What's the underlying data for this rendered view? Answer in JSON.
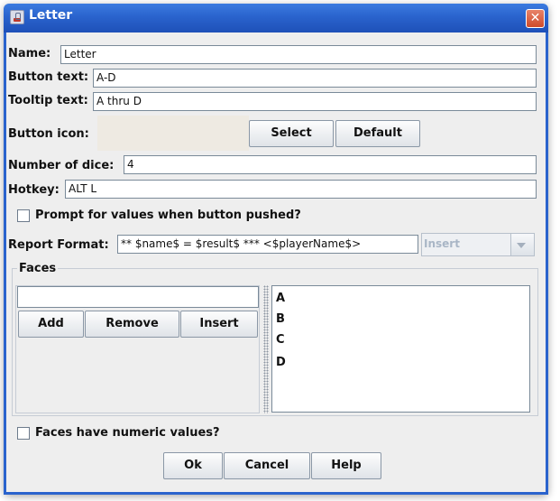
{
  "window": {
    "title": "Letter",
    "close_glyph": "✕"
  },
  "fields": {
    "name_label": "Name:",
    "name_value": "Letter",
    "button_text_label": "Button text:",
    "button_text_value": "A-D",
    "tooltip_label": "Tooltip text:",
    "tooltip_value": "A thru D",
    "icon_label": "Button icon:",
    "select_btn": "Select",
    "default_btn": "Default",
    "dice_label": "Number of dice:",
    "dice_value": "4",
    "hotkey_label": "Hotkey:",
    "hotkey_value": "ALT L"
  },
  "prompt_checkbox": {
    "label": "Prompt for values when button pushed?",
    "checked": false
  },
  "report": {
    "label": "Report Format:",
    "value": "** $name$ = $result$ *** <$playerName$>",
    "insert_label": "Insert"
  },
  "faces": {
    "group_label": "Faces",
    "input_value": "",
    "add_btn": "Add",
    "remove_btn": "Remove",
    "insert_btn": "Insert",
    "items": [
      "A",
      "B",
      "C",
      "D"
    ]
  },
  "numeric_checkbox": {
    "label": "Faces have numeric values?",
    "checked": false
  },
  "footer": {
    "ok": "Ok",
    "cancel": "Cancel",
    "help": "Help"
  },
  "colors": {
    "title_bar": "#2a63cd",
    "close_button": "#d8553a",
    "dialog_bg": "#eeeeee"
  },
  "icons": {
    "window_icon": "java-cup-icon",
    "close": "close-icon",
    "dropdown": "chevron-down-icon"
  }
}
